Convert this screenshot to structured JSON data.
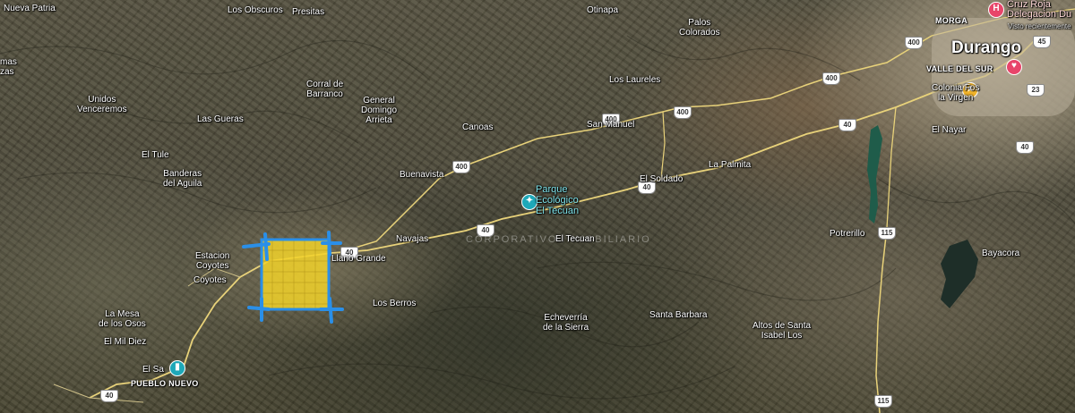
{
  "map": {
    "type": "satellite",
    "colors": {
      "road": "#e8d27a",
      "highlight_fill": "#f2d22a",
      "highlight_border": "#2a8fe8",
      "water": "#1f5c4a"
    },
    "places": [
      {
        "id": "nueva-patria",
        "label": "Nueva Patria"
      },
      {
        "id": "los-obscuros",
        "label": "Los Obscuros"
      },
      {
        "id": "presitas",
        "label": "Presitas"
      },
      {
        "id": "otinapa",
        "label": "Otinapa"
      },
      {
        "id": "palos-colorados",
        "label": "Palos\nColorados"
      },
      {
        "id": "cruz-roja",
        "label": "Cruz Roja\nDelegacion Du"
      },
      {
        "id": "cruz-roja-sub",
        "label": "Visto recientemente"
      },
      {
        "id": "morga",
        "label": "MORGA"
      },
      {
        "id": "durango",
        "label": "Durango"
      },
      {
        "id": "valle-del-sur",
        "label": "VALLE DEL SUR"
      },
      {
        "id": "colonia-fos",
        "label": "Colonia Fos\nla Virgen"
      },
      {
        "id": "el-nayar",
        "label": "El Nayar"
      },
      {
        "id": "unidos-venceremos",
        "label": "Unidos\nVenceremos"
      },
      {
        "id": "corral-de-barranco",
        "label": "Corral de\nBarranco"
      },
      {
        "id": "general-domingo-arrieta",
        "label": "General\nDomingo\nArrieta"
      },
      {
        "id": "los-laureles",
        "label": "Los Laureles"
      },
      {
        "id": "las-gueras",
        "label": "Las Gueras"
      },
      {
        "id": "canoas",
        "label": "Canoas"
      },
      {
        "id": "san-manuel",
        "label": "San Manuel"
      },
      {
        "id": "el-tule",
        "label": "El Tule"
      },
      {
        "id": "buenavista",
        "label": "Buenavista"
      },
      {
        "id": "la-palmita",
        "label": "La Palmita"
      },
      {
        "id": "el-soldado",
        "label": "El Soldado"
      },
      {
        "id": "banderas-del-aguila",
        "label": "Banderas\ndel Aguila"
      },
      {
        "id": "parque-ecologico",
        "label": "Parque\nEcológico\nEl Tecuan"
      },
      {
        "id": "navajas",
        "label": "Navajas"
      },
      {
        "id": "el-tecuan",
        "label": "El Tecuan"
      },
      {
        "id": "potrerillo",
        "label": "Potrerillo"
      },
      {
        "id": "bayacora",
        "label": "Bayacora"
      },
      {
        "id": "estacion-coyotes",
        "label": "Estacion\nCoyotes"
      },
      {
        "id": "llano-grande",
        "label": "Llano Grande"
      },
      {
        "id": "coyotes",
        "label": "Coyotes"
      },
      {
        "id": "los-berros",
        "label": "Los Berros"
      },
      {
        "id": "la-mesa-de-los-osos",
        "label": "La Mesa\nde los Osos"
      },
      {
        "id": "echeverria",
        "label": "Echeverría\nde la Sierra"
      },
      {
        "id": "santa-barbara",
        "label": "Santa Barbara"
      },
      {
        "id": "altos-de-santa-isabel",
        "label": "Altos de Santa\nIsabel Los"
      },
      {
        "id": "el-mil-diez",
        "label": "El Mil Diez"
      },
      {
        "id": "el-salto",
        "label": "El Sa"
      },
      {
        "id": "pueblo-nuevo",
        "label": "PUEBLO NUEVO"
      },
      {
        "id": "las-mas",
        "label": "mas"
      },
      {
        "id": "zas",
        "label": "zas"
      }
    ],
    "shields": [
      {
        "id": "s400-a",
        "label": "400"
      },
      {
        "id": "s400-b",
        "label": "400"
      },
      {
        "id": "s400-c",
        "label": "400"
      },
      {
        "id": "s400-d",
        "label": "400"
      },
      {
        "id": "s400-e",
        "label": "400"
      },
      {
        "id": "s40-a",
        "label": "40"
      },
      {
        "id": "s40-b",
        "label": "40"
      },
      {
        "id": "s40-c",
        "label": "40"
      },
      {
        "id": "s40-d",
        "label": "40"
      },
      {
        "id": "s40-e",
        "label": "40"
      },
      {
        "id": "s45",
        "label": "45"
      },
      {
        "id": "s23",
        "label": "23"
      },
      {
        "id": "s115-a",
        "label": "115"
      },
      {
        "id": "s115-b",
        "label": "115"
      },
      {
        "id": "s40-f",
        "label": "40"
      }
    ],
    "watermark": "CORPORATIVO INMOBILIARIO"
  }
}
